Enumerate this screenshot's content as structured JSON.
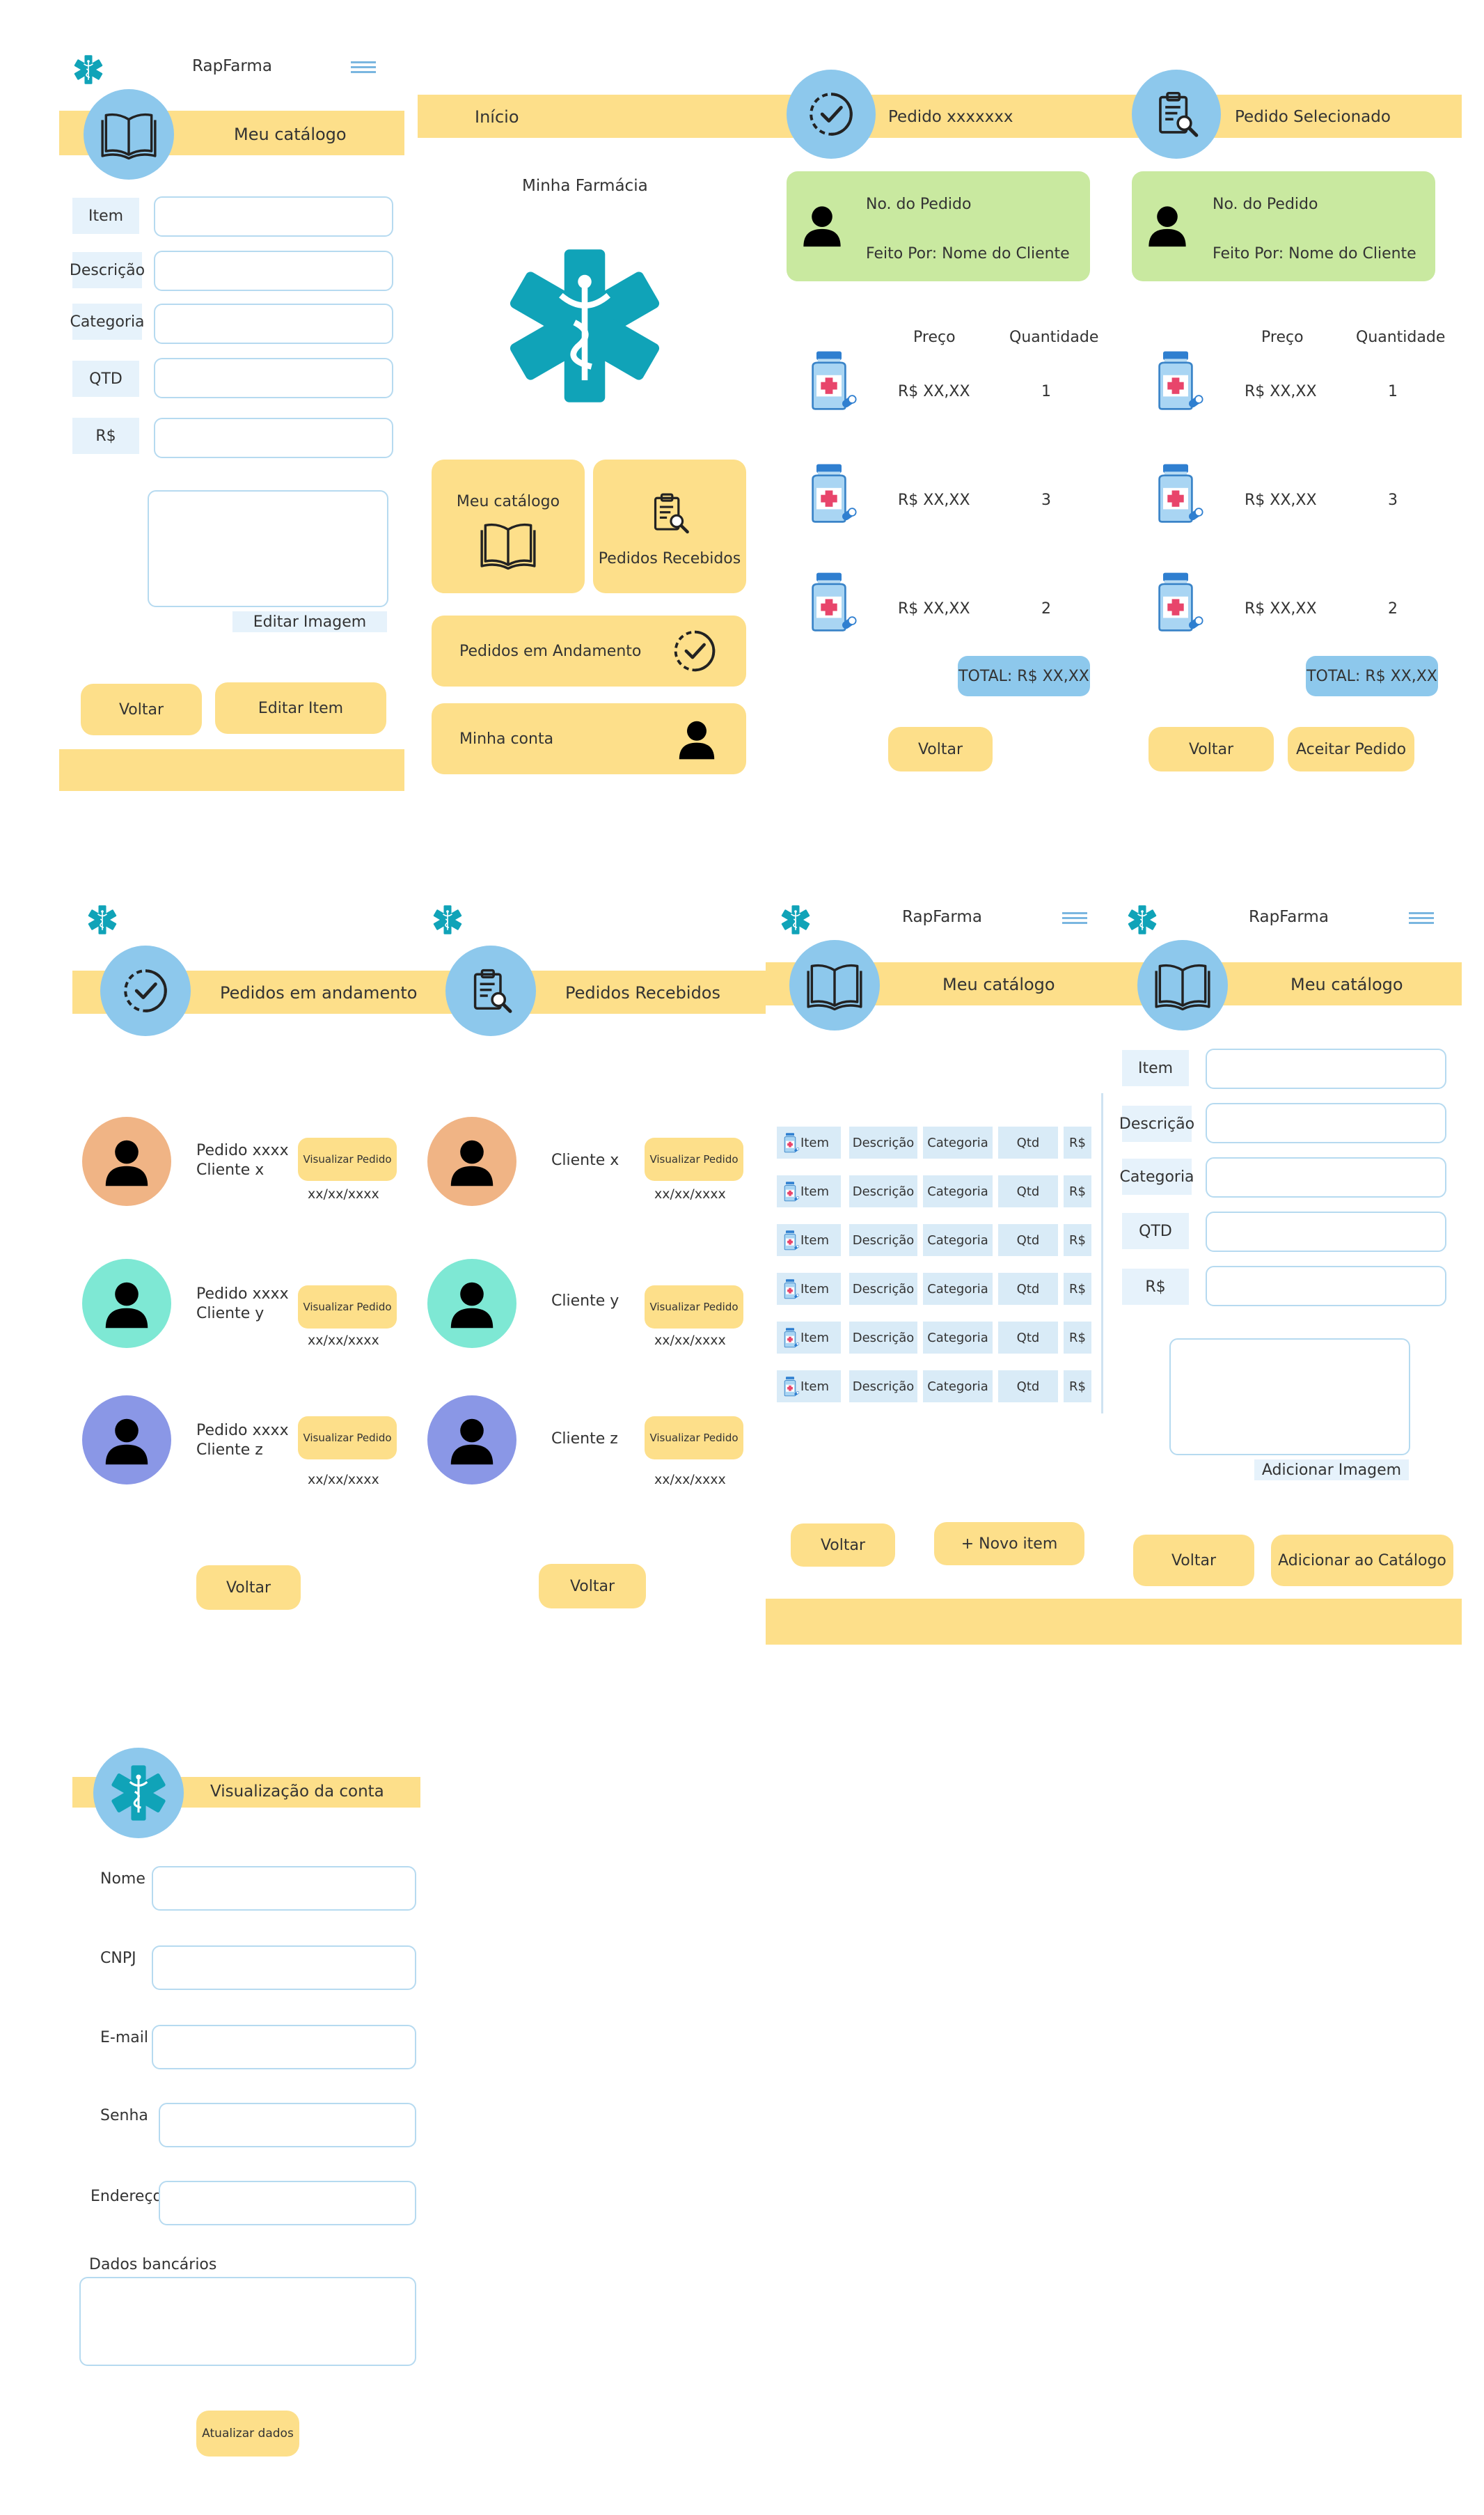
{
  "app_name": "RapFarma",
  "colors": {
    "accent": "#fddf8a",
    "circle": "#8dc8ec",
    "green_card": "#c9e9a0",
    "label_bg": "#e6f2fb",
    "teal_logo": "#10a3b8"
  },
  "screen1": {
    "title": "Meu catálogo",
    "fields": [
      "Item",
      "Descrição",
      "Categoria",
      "QTD",
      "R$"
    ],
    "image_label": "Editar Imagem",
    "back": "Voltar",
    "edit": "Editar Item"
  },
  "screen2": {
    "header": "Início",
    "pharmacy": "Minha Farmácia",
    "catalog": "Meu catálogo",
    "received": "Pedidos Recebidos",
    "in_progress": "Pedidos em Andamento",
    "account": "Minha conta"
  },
  "order": {
    "title": "Pedido xxxxxxx",
    "title_sel": "Pedido Selecionado",
    "no": "No. do Pedido",
    "by": "Feito Por: Nome do Cliente",
    "price_h": "Preço",
    "qty_h": "Quantidade",
    "rows": [
      {
        "price": "R$ XX,XX",
        "qty": "1"
      },
      {
        "price": "R$ XX,XX",
        "qty": "3"
      },
      {
        "price": "R$ XX,XX",
        "qty": "2"
      }
    ],
    "total": "TOTAL: R$ XX,XX",
    "back": "Voltar",
    "accept": "Aceitar Pedido"
  },
  "in_progress": {
    "title": "Pedidos em andamento",
    "items": [
      {
        "l1": "Pedido xxxx",
        "l2": "Cliente x",
        "date": "xx/xx/xxxx"
      },
      {
        "l1": "Pedido xxxx",
        "l2": "Cliente y",
        "date": "xx/xx/xxxx"
      },
      {
        "l1": "Pedido xxxx",
        "l2": "Cliente z",
        "date": "xx/xx/xxxx"
      }
    ],
    "view": "Visualizar Pedido",
    "back": "Voltar"
  },
  "received": {
    "title": "Pedidos Recebidos",
    "items": [
      {
        "client": "Cliente x",
        "date": "xx/xx/xxxx"
      },
      {
        "client": "Cliente y",
        "date": "xx/xx/xxxx"
      },
      {
        "client": "Cliente z",
        "date": "xx/xx/xxxx"
      }
    ],
    "view": "Visualizar Pedido",
    "back": "Voltar"
  },
  "catalog_list": {
    "title": "Meu catálogo",
    "columns": [
      "Item",
      "Descrição",
      "Categoria",
      "Qtd",
      "R$"
    ],
    "back": "Voltar",
    "new": "+ Novo item"
  },
  "catalog_add": {
    "title": "Meu catálogo",
    "fields": [
      "Item",
      "Descrição",
      "Categoria",
      "QTD",
      "R$"
    ],
    "image_label": "Adicionar Imagem",
    "back": "Voltar",
    "add": "Adicionar ao Catálogo"
  },
  "account": {
    "title": "Visualização da conta",
    "fields": [
      "Nome",
      "CNPJ",
      "E-mail",
      "Senha",
      "Endereço"
    ],
    "bank": "Dados bancários",
    "update": "Atualizar dados"
  }
}
